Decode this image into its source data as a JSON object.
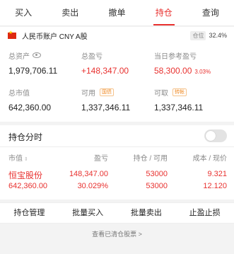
{
  "tabs": [
    {
      "label": "买入",
      "active": false
    },
    {
      "label": "卖出",
      "active": false
    },
    {
      "label": "撤单",
      "active": false
    },
    {
      "label": "持仓",
      "active": true
    },
    {
      "label": "查询",
      "active": false
    }
  ],
  "account": {
    "name": "人民币账户 CNY A股",
    "position_label": "仓位",
    "position_value": "32.4%"
  },
  "summary": {
    "total_assets": {
      "label": "总资产",
      "value": "1,979,706.11",
      "icon": "eye-icon"
    },
    "total_pnl": {
      "label": "总盈亏",
      "value": "+148,347.00"
    },
    "today_pnl": {
      "label": "当日参考盈亏",
      "value": "58,300.00",
      "pct": "3.03%"
    },
    "market_value": {
      "label": "总市值",
      "value": "642,360.00"
    },
    "available": {
      "label": "可用",
      "tag": "国债",
      "value": "1,337,346.11"
    },
    "withdrawable": {
      "label": "可取",
      "tag": "转帐",
      "value": "1,337,346.11"
    }
  },
  "toggle": {
    "label": "持仓分时",
    "on": false
  },
  "table": {
    "headers": {
      "market_value": "市值",
      "pnl": "盈亏",
      "position": "持仓 / 可用",
      "cost": "成本 / 现价"
    },
    "rows": [
      {
        "name": "恒宝股份",
        "market_value": "642,360.00",
        "pnl": "148,347.00",
        "pnl_pct": "30.029%",
        "position": "53000",
        "available": "53000",
        "cost": "9.321",
        "price": "12.120"
      }
    ]
  },
  "actions": [
    "持仓管理",
    "批量买入",
    "批量卖出",
    "止盈止损"
  ],
  "cleared_link": "查看已清仓股票 >",
  "colors": {
    "accent": "#e8312f",
    "tag": "#f08a24"
  }
}
